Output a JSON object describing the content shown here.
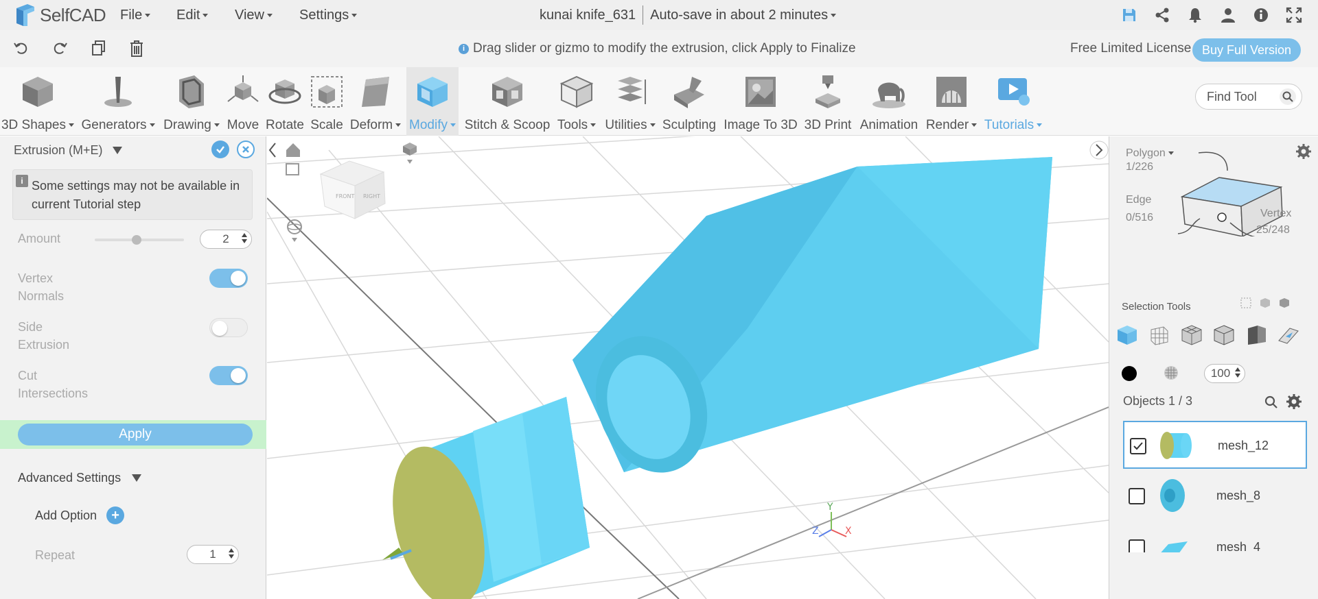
{
  "app": {
    "logo_text": "SelfCAD",
    "menus": [
      "File",
      "Edit",
      "View",
      "Settings"
    ],
    "project_name": "kunai knife_631",
    "autosave": "Auto-save in about 2 minutes"
  },
  "top_icons": [
    "save-icon",
    "share-icon",
    "bell-icon",
    "user-icon",
    "info-icon",
    "fullscreen-icon"
  ],
  "second_bar": {
    "hint": "Drag slider or gizmo to modify the extrusion, click Apply to Finalize",
    "license": "Free Limited License",
    "buy_label": "Buy Full Version"
  },
  "toolbar": {
    "tools": [
      {
        "label": "3D Shapes",
        "caret": true
      },
      {
        "label": "Generators",
        "caret": true
      },
      {
        "label": "Drawing",
        "caret": true
      },
      {
        "label": "Move",
        "caret": false
      },
      {
        "label": "Rotate",
        "caret": false
      },
      {
        "label": "Scale",
        "caret": false
      },
      {
        "label": "Deform",
        "caret": true
      },
      {
        "label": "Modify",
        "caret": true
      },
      {
        "label": "Stitch & Scoop",
        "caret": false
      },
      {
        "label": "Tools",
        "caret": true
      },
      {
        "label": "Utilities",
        "caret": true
      },
      {
        "label": "Sculpting",
        "caret": false
      },
      {
        "label": "Image To 3D",
        "caret": false
      },
      {
        "label": "3D Print",
        "caret": false
      },
      {
        "label": "Animation",
        "caret": false
      },
      {
        "label": "Render",
        "caret": true
      },
      {
        "label": "Tutorials",
        "caret": true
      }
    ],
    "find_placeholder": "Find Tool"
  },
  "left_panel": {
    "title": "Extrusion (M+E)",
    "notice": "Some settings may not be available in current Tutorial step",
    "amount_label": "Amount",
    "amount_value": "2",
    "amount_slider_fraction": 0.47,
    "vertex_normals_label": [
      "Vertex",
      "Normals"
    ],
    "vertex_normals_on": true,
    "side_extrusion_label": [
      "Side",
      "Extrusion"
    ],
    "side_extrusion_on": false,
    "cut_intersections_label": [
      "Cut",
      "Intersections"
    ],
    "cut_intersections_on": true,
    "apply_label": "Apply",
    "advanced_label": "Advanced Settings",
    "add_option_label": "Add Option",
    "repeat_label": "Repeat",
    "repeat_value": "1"
  },
  "right_panel": {
    "polygon_label": "Polygon",
    "polygon_count": "1/226",
    "edge_label": "Edge",
    "edge_count": "0/516",
    "vertex_label": "Vertex",
    "vertex_count": "25/248",
    "selection_tools_label": "Selection Tools",
    "opacity_value": "100",
    "objects_label": "Objects 1 / 3",
    "objects": [
      {
        "name": "mesh_12",
        "checked": true
      },
      {
        "name": "mesh_8",
        "checked": false
      },
      {
        "name": "mesh_4",
        "checked": false
      }
    ]
  },
  "axes": {
    "x": "X",
    "y": "Y",
    "z": "Z"
  },
  "colors": {
    "accent": "#5aa8e0",
    "button": "#7cbfea",
    "mesh": "#5bcdef",
    "face_selected": "#b4bb62",
    "apply_band": "#c8f2cd"
  }
}
